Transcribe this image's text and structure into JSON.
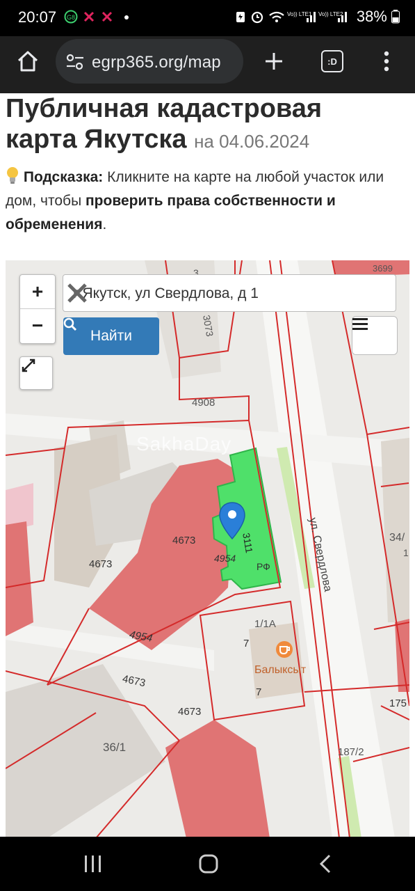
{
  "status_bar": {
    "time": "20:07",
    "battery": "38%",
    "icons": [
      "messenger-icon",
      "missed-call-icon",
      "missed-call-icon",
      "dot-icon",
      "battery-saver-icon",
      "alarm-icon",
      "wifi-icon",
      "signal-lte1-icon",
      "signal-lte2-icon",
      "battery-icon"
    ],
    "network_labels": [
      "Vo)) LTE1",
      "Vo)) LTE2"
    ]
  },
  "browser": {
    "url": "egrp365.org/map",
    "tab_count_label": ":D"
  },
  "page": {
    "title_line1": "Публичная кадастровая",
    "title_line2": "карта Якутска",
    "title_date": "на 04.06.2024",
    "hint_label": "Подсказка:",
    "hint_text1": " Кликните на карте на любой участок или дом, чтобы ",
    "hint_bold": "проверить права собственности и обременения",
    "hint_text2": "."
  },
  "map": {
    "search_value": "г Якутск, ул Свердлова, д 1",
    "find_label": "Найти",
    "zoom_in": "+",
    "zoom_out": "−",
    "watermark": "SakhaDay",
    "street_label": "ул. Свердлова",
    "cafe_label": "Балыксыт",
    "parcel_labels": [
      "4908",
      "3073",
      "4908",
      "4673",
      "4673",
      "4954",
      "3111",
      "РФ",
      "4954",
      "4673",
      "4673",
      "1/1А",
      "7",
      "7",
      "36/1",
      "187/2",
      "3699",
      "34/",
      "175",
      "1",
      "3"
    ],
    "colors": {
      "parcel_fill": "#e07474",
      "parcel_border": "#d42a2a",
      "selected_fill": "#4fe06a",
      "marker": "#2a7fd8",
      "find_button": "#337ab7"
    }
  }
}
